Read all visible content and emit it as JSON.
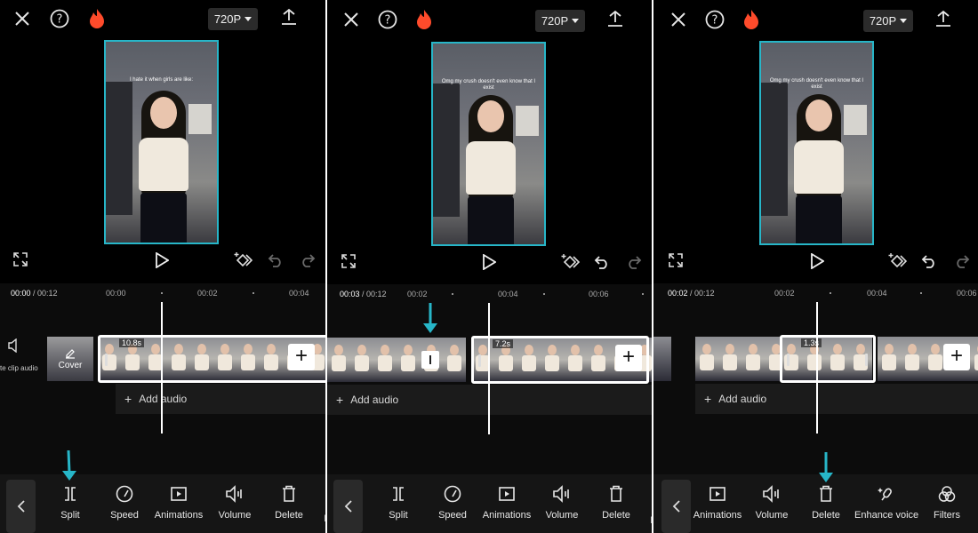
{
  "resolution_label": "720P",
  "cover_label": "Cover",
  "mute_label": "te clip audio",
  "add_audio_label": "Add audio",
  "panels": [
    {
      "caption": "I hate it when girls are like:",
      "time_current": "00:00",
      "time_total": " / 00:12",
      "ticks": [
        "00:00",
        "00:02",
        "00:04"
      ],
      "durations": [
        "10.8s"
      ],
      "tools": [
        "Split",
        "Speed",
        "Animations",
        "Volume",
        "Delete",
        "E"
      ]
    },
    {
      "caption": "Omg my crush doesn't even know that I exist",
      "time_current": "00:03",
      "time_total": " / 00:12",
      "ticks": [
        "00:02",
        "00:04",
        "00:06"
      ],
      "durations": [
        "7.2s"
      ],
      "tools": [
        "Split",
        "Speed",
        "Animations",
        "Volume",
        "Delete",
        "E"
      ]
    },
    {
      "caption": "Omg my crush doesn't even know that I exist",
      "time_current": "00:02",
      "time_total": " / 00:12",
      "ticks": [
        "00:02",
        "00:04",
        "00:06"
      ],
      "durations": [
        "1.3s"
      ],
      "tools": [
        "Animations",
        "Volume",
        "Delete",
        "Enhance voice",
        "Filters"
      ]
    }
  ],
  "colors": {
    "accent": "#27b6c8",
    "flame": "#ff4b2b",
    "background": "#000000"
  }
}
